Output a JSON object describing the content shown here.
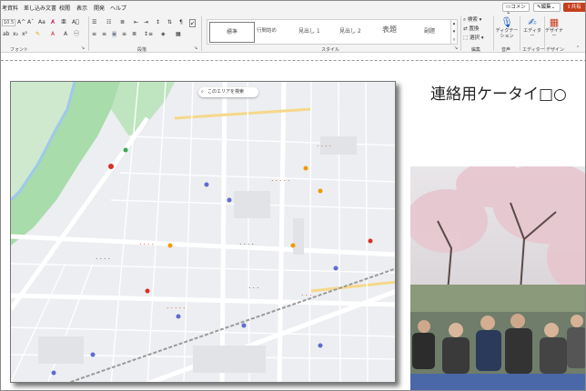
{
  "tabs": {
    "items": [
      "考資料",
      "差し込み文書",
      "校閲",
      "表示",
      "開発",
      "ヘルプ"
    ],
    "comment_label": "コメント",
    "edit_label": "編集",
    "share_label": "共有"
  },
  "ribbon": {
    "font_size": "10.5",
    "groups": {
      "font": "フォント",
      "paragraph": "段落",
      "style": "スタイル",
      "edit": "編集",
      "voice": "音声",
      "editor": "エディター",
      "design": "デザイン"
    },
    "styles": [
      "標準",
      "行間詰め",
      "見出し 1",
      "見出し 2",
      "表題",
      "副題"
    ],
    "search_label": "検索",
    "replace_label": "置換",
    "select_label": "選択",
    "dictation_label": "ディクテーション",
    "editor_label": "エディター",
    "designer_label": "デザイナー"
  },
  "document": {
    "heading": "連絡用ケータイ□○",
    "map_search_label": "このエリアを検索"
  },
  "colors": {
    "accent": "#1f5fbf",
    "share": "#c43e1c",
    "park": "#a8dcaa",
    "road": "#ffffff",
    "water": "#a9cdef"
  }
}
